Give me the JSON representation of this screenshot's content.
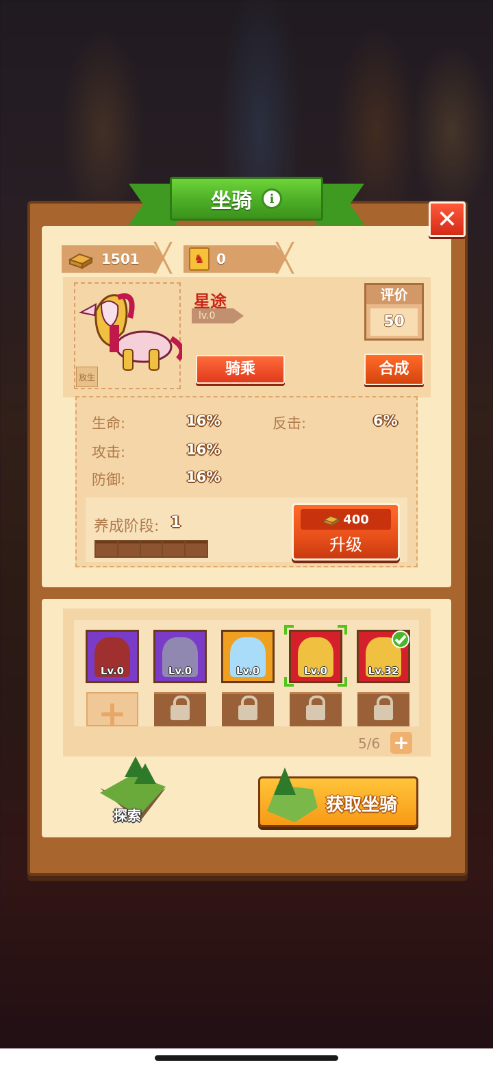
{
  "header": {
    "title": "坐骑",
    "info_icon": "i"
  },
  "close_icon": "✕",
  "currencies": [
    {
      "icon": "gold-bar-icon",
      "value": "1501"
    },
    {
      "icon": "mount-ticket-icon",
      "value": "0"
    }
  ],
  "mount": {
    "name": "星途",
    "level": "lv.0",
    "release_label": "放生",
    "ride_label": "骑乘",
    "rating_label": "评价",
    "rating_value": "50",
    "combine_label": "合成"
  },
  "stats": [
    {
      "label": "生命:",
      "value": "16%"
    },
    {
      "label": "攻击:",
      "value": "16%"
    },
    {
      "label": "防御:",
      "value": "16%"
    },
    {
      "label": "反击:",
      "value": "6%"
    }
  ],
  "training": {
    "stage_label": "养成阶段:",
    "stage_value": "1",
    "progress_filled": 0,
    "progress_total": 5,
    "upgrade_cost": "400",
    "upgrade_label": "升级"
  },
  "mount_slots": [
    {
      "level": "Lv.0",
      "rarity": "purple",
      "state": "normal"
    },
    {
      "level": "Lv.0",
      "rarity": "purple",
      "state": "normal"
    },
    {
      "level": "Lv.0",
      "rarity": "gold",
      "state": "normal"
    },
    {
      "level": "Lv.0",
      "rarity": "red",
      "state": "selected"
    },
    {
      "level": "Lv.32",
      "rarity": "red",
      "state": "equipped"
    }
  ],
  "capacity": {
    "label": "5/6",
    "add_icon": "+"
  },
  "add_slot_icon": "+",
  "explore_label": "探索",
  "obtain_label": "获取坐骑",
  "colors": {
    "title_green": "#4cae26",
    "close_red": "#e03a1c",
    "panel_cream": "#fbe9c2",
    "frame_brown": "#a8652e",
    "rarity_purple": "#7a3cc8",
    "rarity_gold": "#f0a020",
    "rarity_red": "#d4202a",
    "selected_green": "#52c41a"
  }
}
